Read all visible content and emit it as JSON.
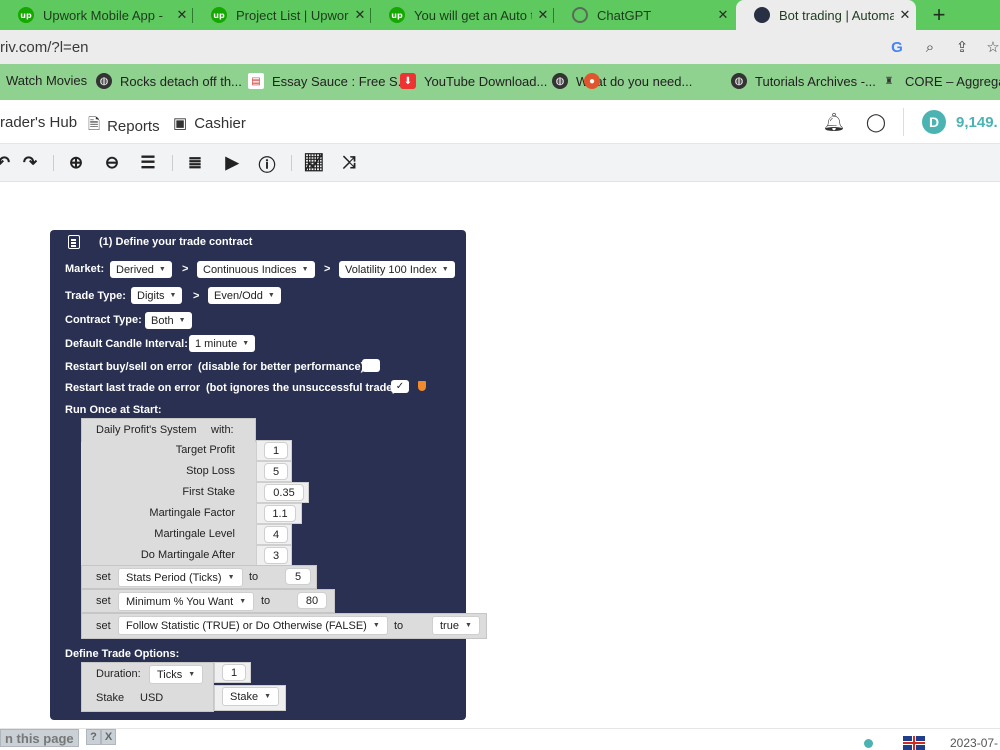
{
  "browser": {
    "tabs": [
      {
        "title": "Upwork Mobile App - ",
        "icon": "upwork-icon"
      },
      {
        "title": "Project List | Upwork",
        "icon": "upwork-icon"
      },
      {
        "title": "You will get an Auto t",
        "icon": "upwork-icon"
      },
      {
        "title": "ChatGPT",
        "icon": "chatgpt-icon"
      },
      {
        "title": "Bot trading | Automat",
        "icon": "deriv-icon"
      }
    ],
    "new_tab": "+",
    "url": "riv.com/?l=en",
    "bookmarks": [
      {
        "label": "Watch Movies"
      },
      {
        "label": "Rocks detach off th..."
      },
      {
        "label": "Essay Sauce : Free S..."
      },
      {
        "label": "YouTube Download..."
      },
      {
        "label": "What do you need..."
      },
      {
        "label": "Tutorials Archives -..."
      },
      {
        "label": "CORE – Aggregati"
      }
    ]
  },
  "header": {
    "nav": [
      {
        "label": "rader's Hub"
      },
      {
        "label": "Reports"
      },
      {
        "label": "Cashier"
      }
    ],
    "balance": "9,149."
  },
  "trade_block": {
    "title": "(1) Define your trade contract",
    "market_label": "Market:",
    "market": "Derived",
    "submarket": "Continuous Indices",
    "symbol": "Volatility 100 Index",
    "trade_type_label": "Trade Type:",
    "trade_type": "Digits",
    "trade_subtype": "Even/Odd",
    "contract_type_label": "Contract Type:",
    "contract_type": "Both",
    "candle_label": "Default Candle Interval:",
    "candle_interval": "1 minute",
    "restart_error_label": "Restart buy/sell on error",
    "restart_error_note": "(disable for better performance):",
    "restart_last_label": "Restart last trade on error",
    "restart_last_note": "(bot ignores the unsuccessful trade):",
    "restart_last_checked": "✓",
    "run_once_label": "Run Once at Start:",
    "define_options_label": "Define Trade Options:",
    "chevron": ">"
  },
  "daily_profit": {
    "header": "Daily Profit's System",
    "with": "with:",
    "params": [
      {
        "label": "Target Profit",
        "value": "1"
      },
      {
        "label": "Stop Loss",
        "value": "5"
      },
      {
        "label": "First Stake",
        "value": "0.35"
      },
      {
        "label": "Martingale Factor",
        "value": "1.1"
      },
      {
        "label": "Martingale Level",
        "value": "4"
      },
      {
        "label": "Do Martingale After",
        "value": "3"
      }
    ]
  },
  "set_blocks": [
    {
      "set": "set",
      "variable": "Stats Period (Ticks)",
      "to": "to",
      "value": "5"
    },
    {
      "set": "set",
      "variable": "Minimum % You Want",
      "to": "to",
      "value": "80"
    },
    {
      "set": "set",
      "variable": "Follow Statistic (TRUE) or Do Otherwise (FALSE)",
      "to": "to",
      "value": "true"
    }
  ],
  "trade_options": {
    "duration_label": "Duration:",
    "duration_unit": "Ticks",
    "duration_value": "1",
    "stake_label": "Stake",
    "currency": "USD",
    "stake_var": "Stake"
  },
  "footer": {
    "translate": "n this page",
    "help": "?",
    "close": "X",
    "date": "2023-07-"
  },
  "colors": {
    "tabbar": "#5ec95e",
    "bookmarks": "#8fd18f",
    "block_dark": "#2a3052",
    "balance": "#4bb4b3"
  }
}
